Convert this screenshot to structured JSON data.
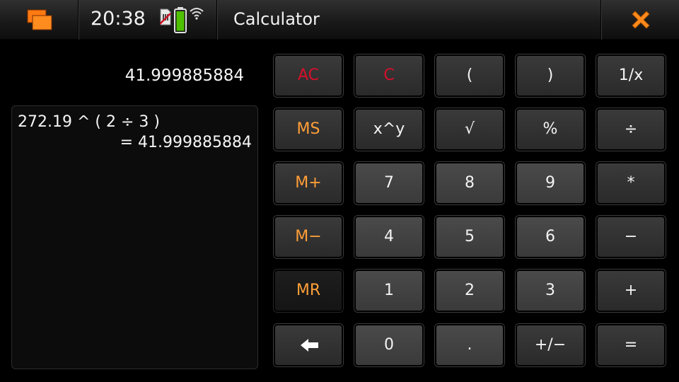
{
  "statusbar": {
    "clock": "20:38",
    "icons": [
      "task-switcher-icon",
      "sim-card-icon",
      "battery-icon",
      "wifi-icon"
    ],
    "battery_color": "#4ec000"
  },
  "app": {
    "title": "Calculator",
    "close_icon_color": "#ff8a1c"
  },
  "display": {
    "result": "41.999885884",
    "tape": {
      "expression": "272.19 ^ ( 2 ÷ 3 )",
      "result": "= 41.999885884"
    }
  },
  "keypad": {
    "colors": {
      "clear": "#d5102a",
      "memory": "#ff9f38",
      "default": "#f3f3f3"
    },
    "rows": [
      [
        "AC",
        "C",
        "(",
        ")",
        "1/x"
      ],
      [
        "MS",
        "x^y",
        "√",
        "%",
        "÷"
      ],
      [
        "M+",
        "7",
        "8",
        "9",
        "*"
      ],
      [
        "M−",
        "4",
        "5",
        "6",
        "−"
      ],
      [
        "MR",
        "1",
        "2",
        "3",
        "+"
      ],
      [
        "",
        "0",
        ".",
        "+/−",
        "="
      ]
    ],
    "backspace_icon": "backspace-arrow-icon"
  }
}
